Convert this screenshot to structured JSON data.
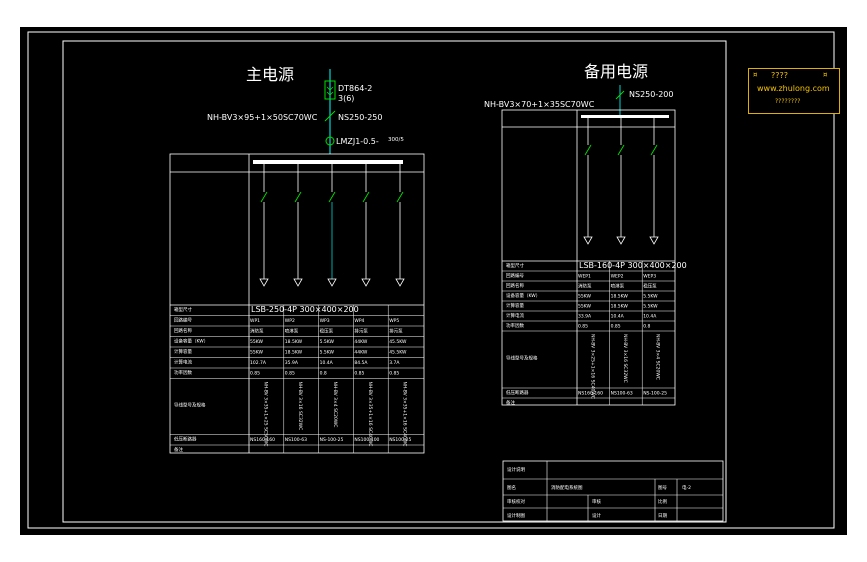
{
  "main": {
    "title": "主电源",
    "meter": "DT864-2",
    "meter_rating": "3(6)",
    "cable": "NH-BV3×95+1×50SC70WC",
    "breaker": "NS250-250",
    "ct": "LMZJ1-0.5-",
    "ct_ratio": "300/5",
    "row_labels": [
      "箱型尺寸",
      "回路编号",
      "回路名称",
      "设备容量（KW）",
      "计算容量",
      "计算电流",
      "功率因数",
      "导线型号及规格",
      "低压断路器",
      "备注"
    ],
    "box_size": "LSB-250-4P  300×400×200",
    "circuits": [
      {
        "id": "WP1",
        "name": "消防泵",
        "capacity": "55KW",
        "calc": "55KW",
        "current": "102.7A",
        "pf": "0.85",
        "cable": "NH-BV 3×35+1×25 SC50WC",
        "breaker": "NS160-160"
      },
      {
        "id": "WP2",
        "name": "喷淋泵",
        "capacity": "18.5KW",
        "calc": "18.5KW",
        "current": "35.9A",
        "pf": "0.85",
        "cable": "NH-BV 3×16 SC32WC",
        "breaker": "NS100-63"
      },
      {
        "id": "WP3",
        "name": "稳压泵",
        "capacity": "5.5KW",
        "calc": "5.5KW",
        "current": "10.4A",
        "pf": "0.8",
        "cable": "NH-BV 3×4 SC20WC",
        "breaker": "NS-100-25"
      },
      {
        "id": "WP4",
        "name": "排污泵",
        "capacity": "44KW",
        "calc": "44KW",
        "current": "84.5A",
        "pf": "0.85",
        "cable": "NH-BV 3×35+1×16 SC40WC",
        "breaker": "NS100-100"
      },
      {
        "id": "WP5",
        "name": "排污泵",
        "capacity": "45.5KW",
        "calc": "45.5KW",
        "current": "3.7A",
        "pf": "0.85",
        "cable": "NH-BV 3×35+1×16 SC40WC",
        "breaker": "NS100-25"
      }
    ]
  },
  "backup": {
    "title": "备用电源",
    "cable": "NH-BV3×70+1×35SC70WC",
    "breaker": "NS250-200",
    "row_labels": [
      "箱型尺寸",
      "回路编号",
      "回路名称",
      "设备容量（KW）",
      "计算容量",
      "计算电流",
      "功率因数",
      "导线型号及规格",
      "低压断路器",
      "备注"
    ],
    "box_size": "LSB-160-4P  300×400×200",
    "circuits": [
      {
        "id": "WEP1",
        "name": "消防泵",
        "capacity": "55KW",
        "calc": "55KW",
        "current": "33.9A",
        "pf": "0.85",
        "cable": "NH-BV 3×25+1×16 SC40WC",
        "breaker": "NS160-160"
      },
      {
        "id": "WEP2",
        "name": "喷淋泵",
        "capacity": "18.5KW",
        "calc": "18.5KW",
        "current": "10.4A",
        "pf": "0.85",
        "cable": "NH-BV 3×16 SC32WC",
        "breaker": "NS100-63"
      },
      {
        "id": "WEP3",
        "name": "稳压泵",
        "capacity": "5.5KW",
        "calc": "5.5KW",
        "current": "10.4A",
        "pf": "0.8",
        "cable": "NH-BV 3×4 SC20WC",
        "breaker": "NS-100-25"
      }
    ]
  },
  "title_block": {
    "r1": "设计说明",
    "r2a": "图名",
    "r2b": "消防配电系统图",
    "r2c": "图号",
    "r2d": "电-2",
    "r3a": "审核校对",
    "r3b": "审核",
    "r3c": "比例",
    "r4a": "设计制图",
    "r4b": "设计",
    "r4c": "日期"
  },
  "logo": {
    "line1": "????",
    "line2": "www.zhulong.com",
    "line3": "????????",
    "mark1": "¤",
    "mark2": "¤"
  },
  "colors": {
    "background": "#000000",
    "line": "#ffffff",
    "bus_wire": "#00d4d4",
    "green": "#00e000",
    "logo": "#f2c200"
  }
}
